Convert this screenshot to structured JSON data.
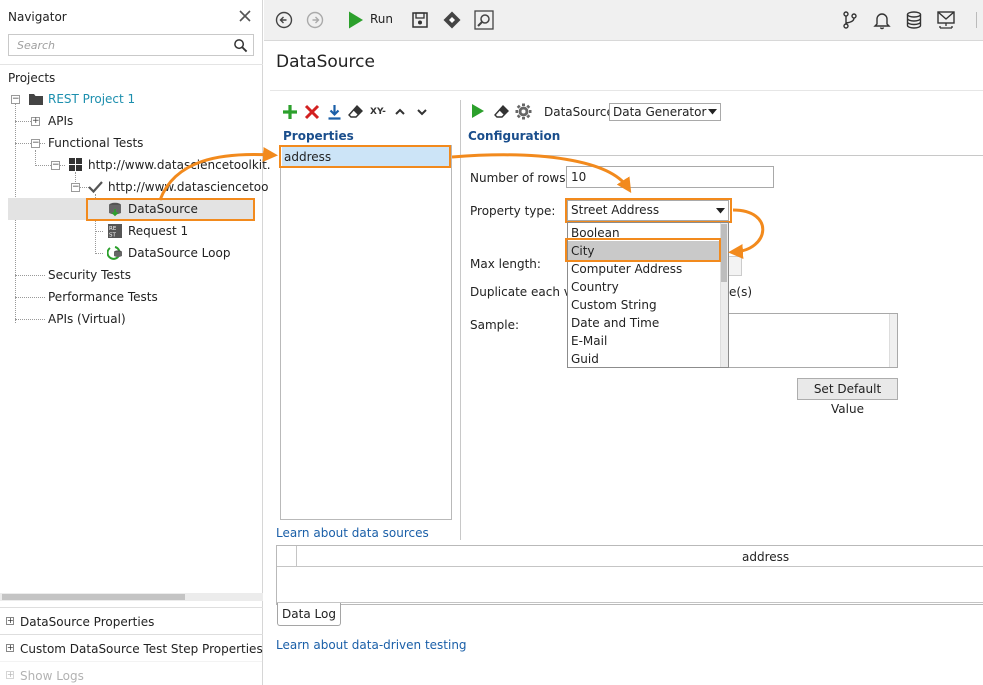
{
  "navigator": {
    "title": "Navigator",
    "search_placeholder": "Search",
    "projects_label": "Projects",
    "tree": [
      {
        "label": "REST Project 1"
      },
      {
        "label": "APIs"
      },
      {
        "label": "Functional Tests"
      },
      {
        "label": "http://www.datasciencetoolkit."
      },
      {
        "label": "http://www.datasciencetoo"
      },
      {
        "label": "DataSource"
      },
      {
        "label": "Request 1"
      },
      {
        "label": "DataSource Loop"
      },
      {
        "label": "Security Tests"
      },
      {
        "label": "Performance Tests"
      },
      {
        "label": "APIs (Virtual)"
      }
    ],
    "bottom_panels": [
      {
        "label": "DataSource Properties"
      },
      {
        "label": "Custom DataSource Test Step Properties"
      },
      {
        "label": "Show Logs"
      }
    ]
  },
  "toolbar": {
    "run_label": "Run"
  },
  "main": {
    "title": "DataSource",
    "properties": {
      "label": "Properties",
      "toolbar_xy": "XY-",
      "items": [
        {
          "name": "address"
        }
      ],
      "learn_link": "Learn about data sources"
    },
    "configuration": {
      "label": "Configuration",
      "datasource_label": "DataSource:",
      "datasource_value": "Data Generator",
      "rows_label": "Number of rows:",
      "rows_value": "10",
      "property_type_label": "Property type:",
      "property_type_value": "Street Address",
      "max_length_label": "Max length:",
      "duplicate_label": "Duplicate each val",
      "duplicate_suffix": "e(s)",
      "sample_label": "Sample:",
      "set_default_button": "Set Default Value",
      "dropdown_options": [
        {
          "label": "Boolean"
        },
        {
          "label": "City"
        },
        {
          "label": "Computer Address"
        },
        {
          "label": "Country"
        },
        {
          "label": "Custom String"
        },
        {
          "label": "Date and Time"
        },
        {
          "label": "E-Mail"
        },
        {
          "label": "Guid"
        }
      ],
      "dropdown_selected": "City"
    },
    "datalog": {
      "column": "address",
      "tab_label": "Data Log"
    },
    "learn_ddt_link": "Learn about data-driven testing"
  },
  "colors": {
    "highlight": "#f28a1d",
    "selection": "#cce4f7",
    "link": "#1a5fa8",
    "heading": "#1a4e8c",
    "run_green": "#2ca02c",
    "delete_red": "#d32020"
  }
}
